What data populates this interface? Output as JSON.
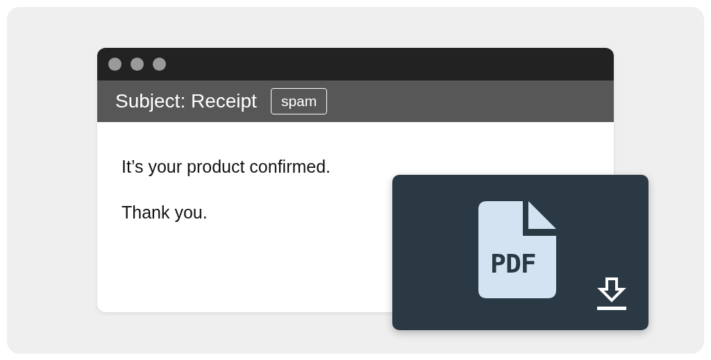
{
  "window": {
    "subject": "Subject: Receipt",
    "tag": "spam",
    "body": [
      "It’s your product confirmed.",
      "Thank you."
    ]
  },
  "attachment": {
    "file_type": "PDF"
  }
}
